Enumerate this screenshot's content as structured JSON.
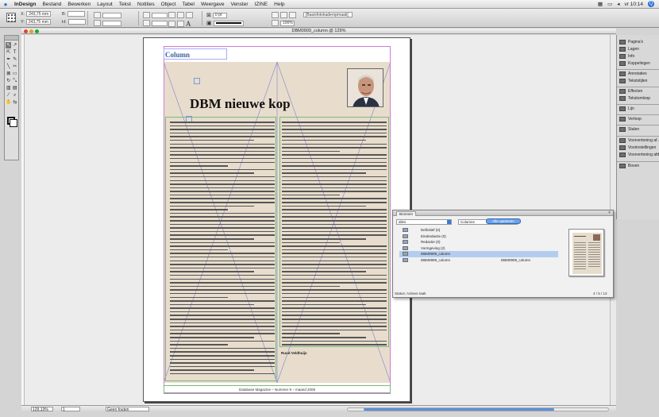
{
  "menubar": {
    "app": "InDesign",
    "items": [
      "Bestand",
      "Bewerken",
      "Layout",
      "Tekst",
      "Notities",
      "Object",
      "Tabel",
      "Weergave",
      "Venster",
      "IZINE",
      "Help"
    ],
    "clock": "vr 10:14",
    "user_badge": "Q"
  },
  "control": {
    "x_label": "X:",
    "x_value": "243,75 mm",
    "y_label": "Y:",
    "y_value": "243,75 mm",
    "w_label": "B:",
    "h_label": "H:",
    "stroke_weight": "0 pt",
    "zoom_pct": "100%",
    "style_dropdown": "[Basisfotokaderopmaak]"
  },
  "doc": {
    "title": "DBM0909_column @ 129%",
    "column_label": "Column",
    "headline": "DBM nieuwe kop",
    "byline_name": "Ruud Veldhuijs",
    "footer": "Database Magazine – Nummer 9 – maand 2009",
    "colors": {
      "beige": "#e8ddcd",
      "guide_green": "#7ab87a",
      "margin_magenta": "#d27ad2",
      "accent_blue": "#3a5fa0"
    }
  },
  "tools": {
    "items": [
      "arrow-select",
      "direct-select",
      "position",
      "text",
      "pen",
      "pencil",
      "line",
      "scissors",
      "frame",
      "rect",
      "rotate",
      "scale",
      "gradient",
      "note",
      "eyedropper",
      "zoom",
      "hand",
      "swap"
    ]
  },
  "dock": {
    "items": [
      "Pagina's",
      "Lagen",
      "Info",
      "Koppelingen",
      "Annotaties",
      "Tekststijlen",
      "Effecten",
      "Tekstomloop",
      "Lijn",
      "Verloop",
      "Stalen",
      "Voorvertoning af...",
      "Voorinstellingen",
      "Voorvertoning afd...",
      "Boven"
    ]
  },
  "popup": {
    "tab": "Bronnen",
    "filter": "alles",
    "sort": "Columns",
    "button": "Alle opnemen",
    "rows": [
      {
        "name": "Definitief (0)",
        "extra": "",
        "selected": false
      },
      {
        "name": "Eindredactie (0)",
        "extra": "",
        "selected": false
      },
      {
        "name": "Redactie (0)",
        "extra": "",
        "selected": false
      },
      {
        "name": "Vormgeving (2)",
        "extra": "",
        "selected": false
      },
      {
        "name": "DBM0909_column",
        "extra": "",
        "selected": true
      },
      {
        "name": "DBM0909_column",
        "extra": "DBM0909_column",
        "selected": false
      }
    ],
    "footer_left": "Status: Actieve taak",
    "footer_right": "4 / 5 / 13"
  },
  "status": {
    "zoom": "129,13%",
    "page": "1",
    "preflight": "Geen fouten"
  }
}
